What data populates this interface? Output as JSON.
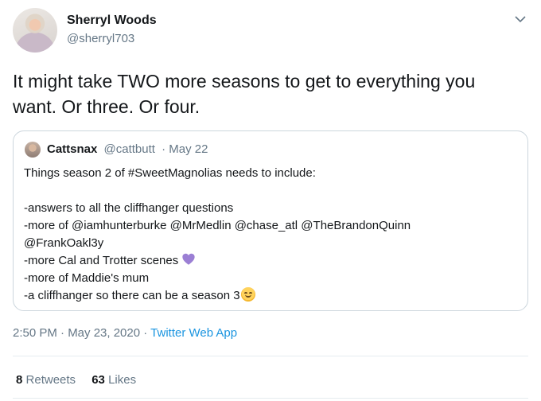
{
  "author": {
    "name": "Sherryl Woods",
    "handle": "@sherryl703"
  },
  "tweet": {
    "text": "It might take TWO more seasons to get to everything you want. Or three. Or four."
  },
  "quoted": {
    "name": "Cattsnax",
    "handle": "@cattbutt",
    "date": "· May 22",
    "lines": [
      "Things season 2 of #SweetMagnolias needs to include:",
      "-answers to all the cliffhanger questions",
      "-more of @iamhunterburke @MrMedlin @chase_atl @TheBrandonQuinn",
      "@FrankOakl3y",
      "-more Cal and Trotter scenes",
      "-more of Maddie's mum",
      "-a cliffhanger so there can be a season 3"
    ]
  },
  "meta": {
    "time_date": "2:50 PM · May 23, 2020 · ",
    "source": "Twitter Web App"
  },
  "stats": {
    "retweets_count": "8",
    "retweets_label": "Retweets",
    "likes_count": "63",
    "likes_label": "Likes"
  },
  "icons": {
    "chevron": "chevron-down-icon",
    "heart": "purple-heart-emoji",
    "face": "smirking-face-emoji"
  },
  "colors": {
    "link": "#1b95e0",
    "muted": "#657786",
    "heart": "#9b7fd4"
  }
}
